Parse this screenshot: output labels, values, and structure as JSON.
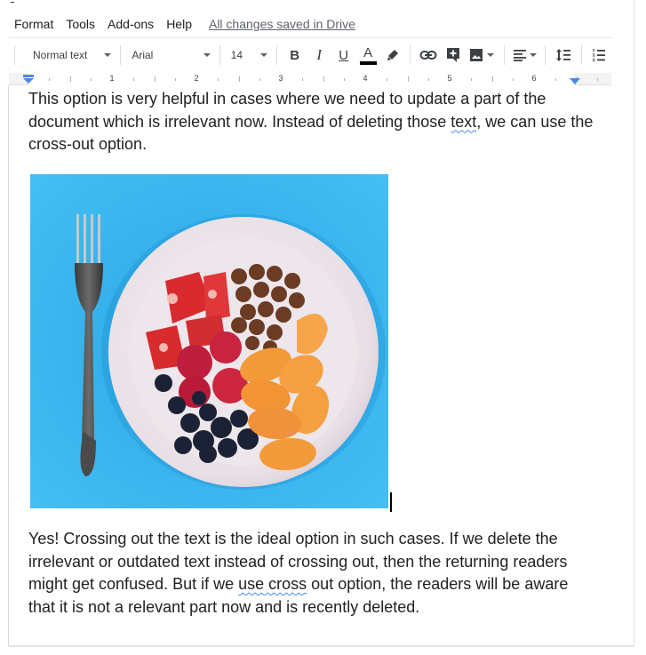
{
  "menubar": {
    "items": [
      "Format",
      "Tools",
      "Add-ons",
      "Help"
    ],
    "save_status": "All changes saved in Drive"
  },
  "toolbar": {
    "paragraph_style": "Normal text",
    "font_family": "Arial",
    "font_size": "14",
    "bold_label": "B",
    "italic_label": "I",
    "underline_label": "U",
    "text_color_label": "A",
    "text_color": "#000000",
    "icons": [
      "highlight-pen-icon",
      "link-icon",
      "add-comment-icon",
      "insert-image-icon",
      "align-left-icon",
      "line-spacing-icon",
      "numbered-list-icon"
    ]
  },
  "ruler": {
    "labels": [
      "1",
      "2",
      "3",
      "4",
      "5",
      "6"
    ],
    "marker_color": "#4a86e8"
  },
  "document": {
    "paragraph1": {
      "before": "This option is very helpful in cases where we need to update a part of the document which is irrelevant now. Instead of deleting those ",
      "flagged": "text",
      "after": ", we can use the cross-out option."
    },
    "image": {
      "alt": "Bowl of strawberries, raspberries, blueberries, hazelnuts and tangerine segments with a fork on a blue background",
      "background_color": "#3db8ef"
    },
    "paragraph2": {
      "before": "Yes! Crossing out the text is the ideal option in such cases. If we delete the irrelevant or outdated text instead of crossing out, then the returning readers might get confused. But if we ",
      "flagged": "use cross",
      "after": " out option, the readers will be aware that it is not a relevant part now and is recently deleted."
    }
  }
}
